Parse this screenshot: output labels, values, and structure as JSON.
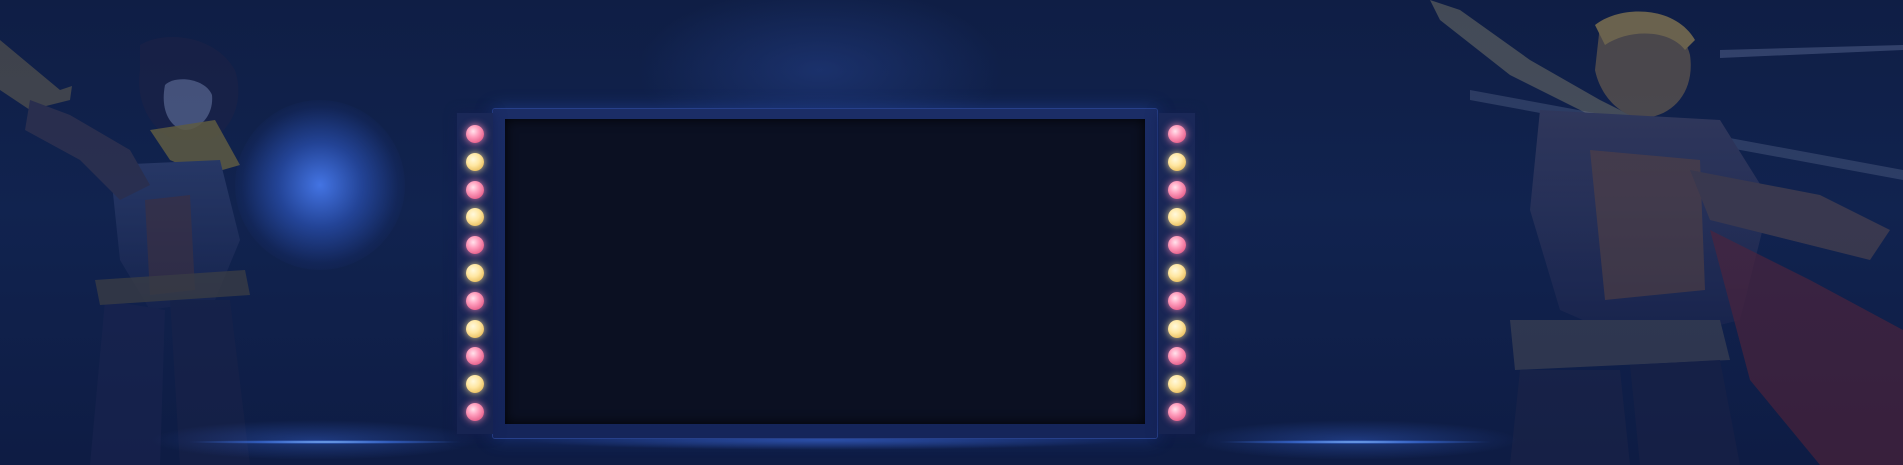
{
  "scene": {
    "background": "#0f1d42",
    "accent_glow": "#4678eb",
    "screen_color": "#0b1022",
    "frame_color": "#1b2d66"
  },
  "left_lights": {
    "pattern": [
      "pink",
      "yellow",
      "pink",
      "yellow",
      "pink",
      "yellow",
      "pink",
      "yellow",
      "pink",
      "yellow",
      "pink"
    ]
  },
  "right_lights": {
    "pattern": [
      "pink",
      "yellow",
      "pink",
      "yellow",
      "pink",
      "yellow",
      "pink",
      "yellow",
      "pink",
      "yellow",
      "pink"
    ]
  },
  "characters": {
    "left": "gunslinger-girl-character",
    "right": "lightning-archer-character"
  }
}
